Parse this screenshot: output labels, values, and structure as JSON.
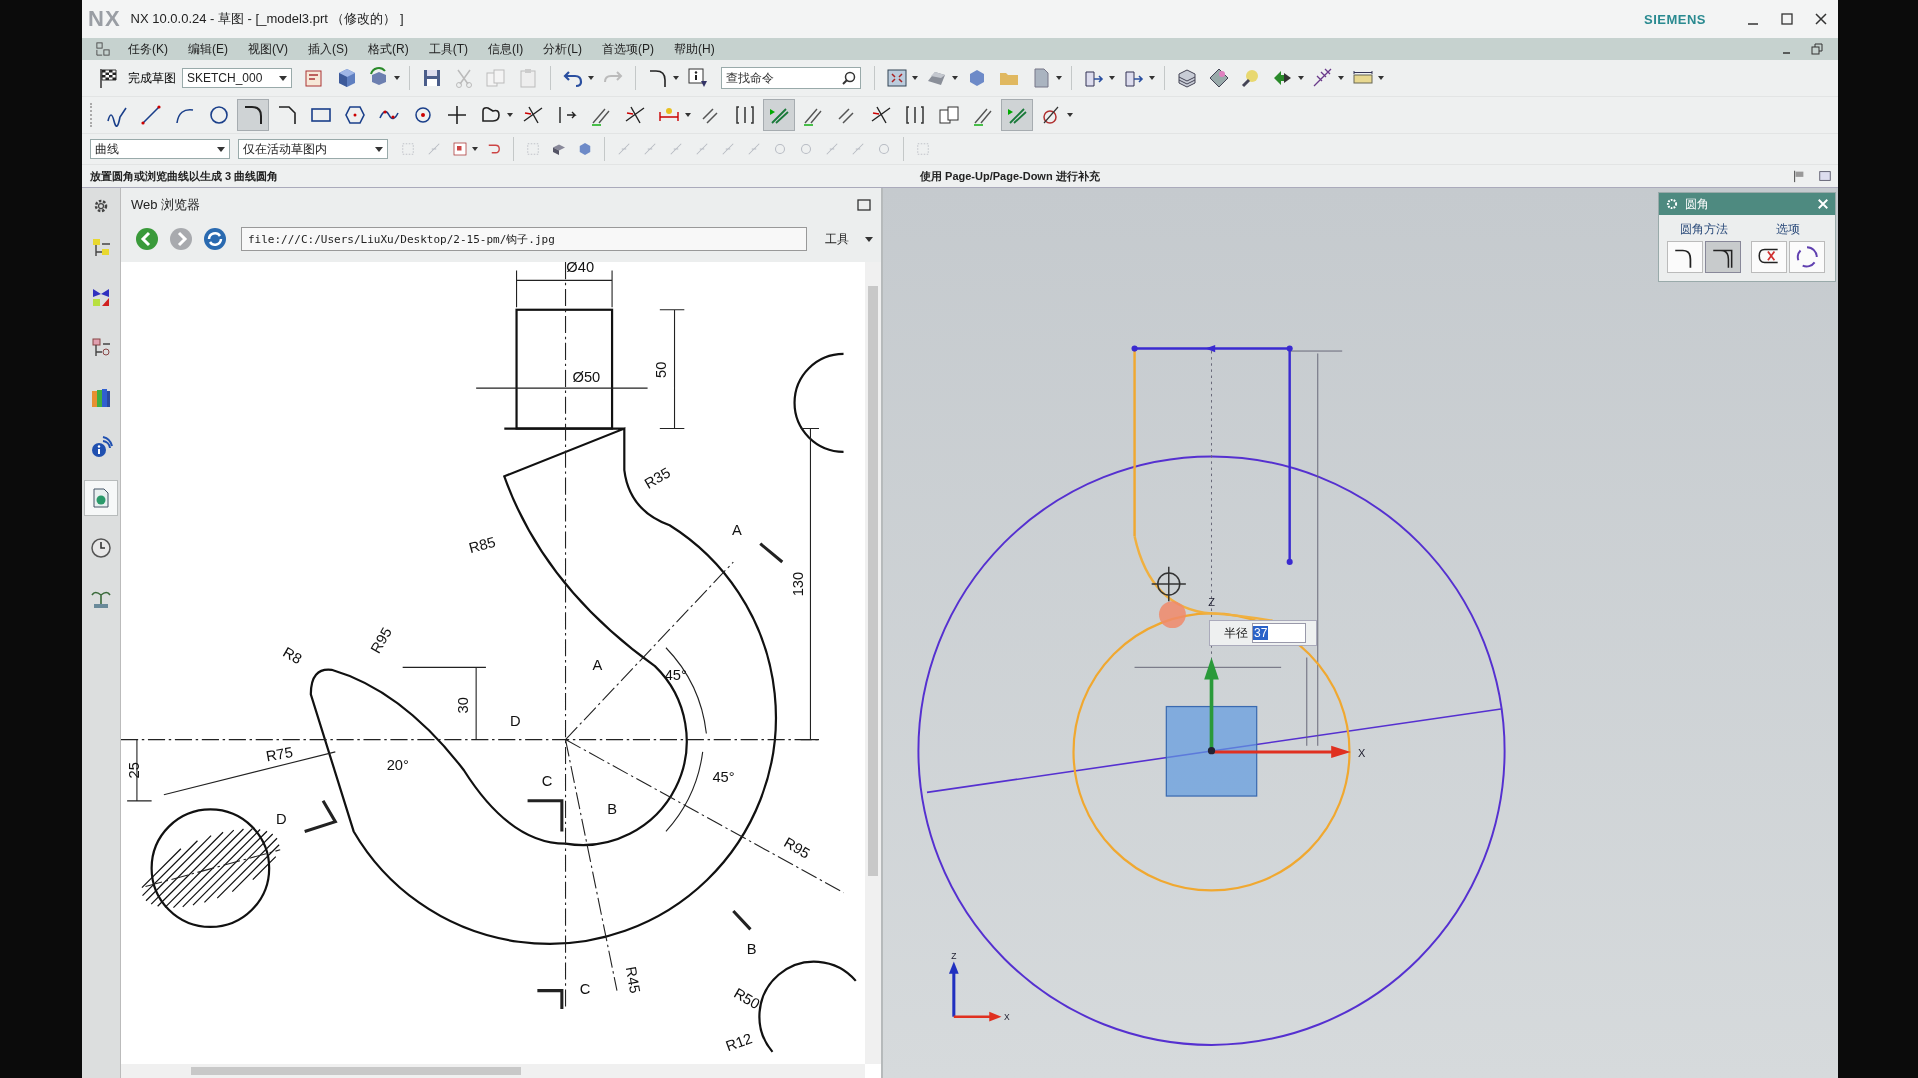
{
  "window": {
    "logo": "NX",
    "title": "NX 10.0.0.24 - 草图 - [_model3.prt （修改的） ]",
    "brand": "SIEMENS"
  },
  "menu": [
    {
      "label": "任务(K)"
    },
    {
      "label": "编辑(E)"
    },
    {
      "label": "视图(V)"
    },
    {
      "label": "插入(S)"
    },
    {
      "label": "格式(R)"
    },
    {
      "label": "工具(T)"
    },
    {
      "label": "信息(I)"
    },
    {
      "label": "分析(L)"
    },
    {
      "label": "首选项(P)"
    },
    {
      "label": "帮助(H)"
    }
  ],
  "toolbar": {
    "finish_sketch": "完成草图",
    "sketch_name": "SKETCH_000",
    "command_search": {
      "placeholder": "查找命令"
    }
  },
  "sketch_tools": [
    {
      "kind": "profile",
      "selected": false
    },
    {
      "kind": "line",
      "selected": false
    },
    {
      "kind": "arc",
      "selected": false
    },
    {
      "kind": "circle",
      "selected": false
    },
    {
      "kind": "fillet",
      "selected": true
    },
    {
      "kind": "chamfer",
      "selected": false
    },
    {
      "kind": "rectangle",
      "selected": false
    },
    {
      "kind": "polygon",
      "selected": false
    },
    {
      "kind": "spline",
      "selected": false
    },
    {
      "kind": "point",
      "selected": false
    },
    {
      "kind": "cross",
      "selected": false
    },
    {
      "kind": "offset",
      "selected": false
    },
    {
      "kind": "trim",
      "selected": false
    },
    {
      "kind": "extend",
      "selected": false
    },
    {
      "kind": "corner",
      "selected": false
    },
    {
      "kind": "trim",
      "selected": false
    },
    {
      "kind": "dimension",
      "selected": false
    },
    {
      "kind": "constraint",
      "selected": false
    },
    {
      "kind": "bracket",
      "selected": false
    },
    {
      "kind": "auto_dimension",
      "selected": true
    },
    {
      "kind": "corner",
      "selected": false
    },
    {
      "kind": "constraint",
      "selected": false
    },
    {
      "kind": "trim",
      "selected": false
    },
    {
      "kind": "bracket",
      "selected": false
    },
    {
      "kind": "copy",
      "selected": false
    },
    {
      "kind": "corner",
      "selected": false
    },
    {
      "kind": "auto_dimension",
      "selected": true
    },
    {
      "kind": "relations",
      "selected": false
    }
  ],
  "selection_bar": {
    "type_filter": "曲线",
    "scope_filter": "仅在活动草图内"
  },
  "cue_line": "放置圆角或浏览曲线以生成 3 曲线圆角",
  "status_line": "使用 Page-Up/Page-Down 进行补充",
  "resource_bar": [
    {
      "kind": "assembly",
      "selected": false
    },
    {
      "kind": "constraints",
      "selected": false
    },
    {
      "kind": "part",
      "selected": false
    },
    {
      "kind": "library",
      "selected": false
    },
    {
      "kind": "info",
      "selected": false
    },
    {
      "kind": "web",
      "selected": true
    },
    {
      "kind": "history",
      "selected": false
    },
    {
      "kind": "palette",
      "selected": false
    }
  ],
  "web_browser": {
    "title": "Web 浏览器",
    "url": "file:///C:/Users/LiuXu/Desktop/2-15-pm/钩子.jpg",
    "tools_menu": "工具",
    "drawing_labels": [
      "Ø40",
      "Ø50",
      "50",
      "R35",
      "R85",
      "A",
      "130",
      "R95",
      "R8",
      "30",
      "D",
      "45°",
      "A",
      "R75",
      "20°",
      "25",
      "C",
      "B",
      "45°",
      "D",
      "R95",
      "B",
      "R50",
      "R45",
      "C",
      "R12"
    ]
  },
  "graphics": {
    "axis_labels": [
      "Z",
      "X"
    ],
    "triad_labels": [
      "Z",
      "X"
    ]
  },
  "fillet_dialog": {
    "title": "圆角",
    "method_group": {
      "label": "圆角方法",
      "options": [
        {
          "kind": "trim",
          "selected": false
        },
        {
          "kind": "untrim",
          "selected": true
        }
      ]
    },
    "options_group": {
      "label": "选项",
      "options": [
        {
          "kind": "delete_third",
          "selected": false
        },
        {
          "kind": "alternate",
          "selected": false
        }
      ]
    }
  },
  "radius_input": {
    "label": "半径",
    "value": "37"
  }
}
